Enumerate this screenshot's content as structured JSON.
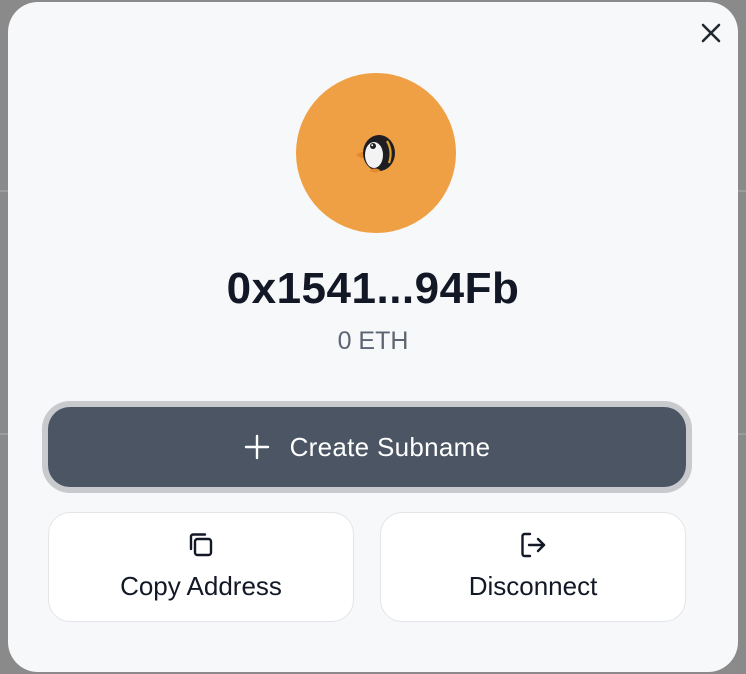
{
  "modal": {
    "close_icon": "close-icon",
    "avatar_emoji": "penguin",
    "avatar_color": "#f0a044",
    "address": "0x1541...94Fb",
    "balance": "0 ETH"
  },
  "actions": {
    "create_subname": {
      "label": "Create Subname",
      "icon": "plus-icon",
      "bg_color": "#4b5563"
    },
    "copy_address": {
      "label": "Copy Address",
      "icon": "copy-icon"
    },
    "disconnect": {
      "label": "Disconnect",
      "icon": "logout-icon"
    }
  }
}
